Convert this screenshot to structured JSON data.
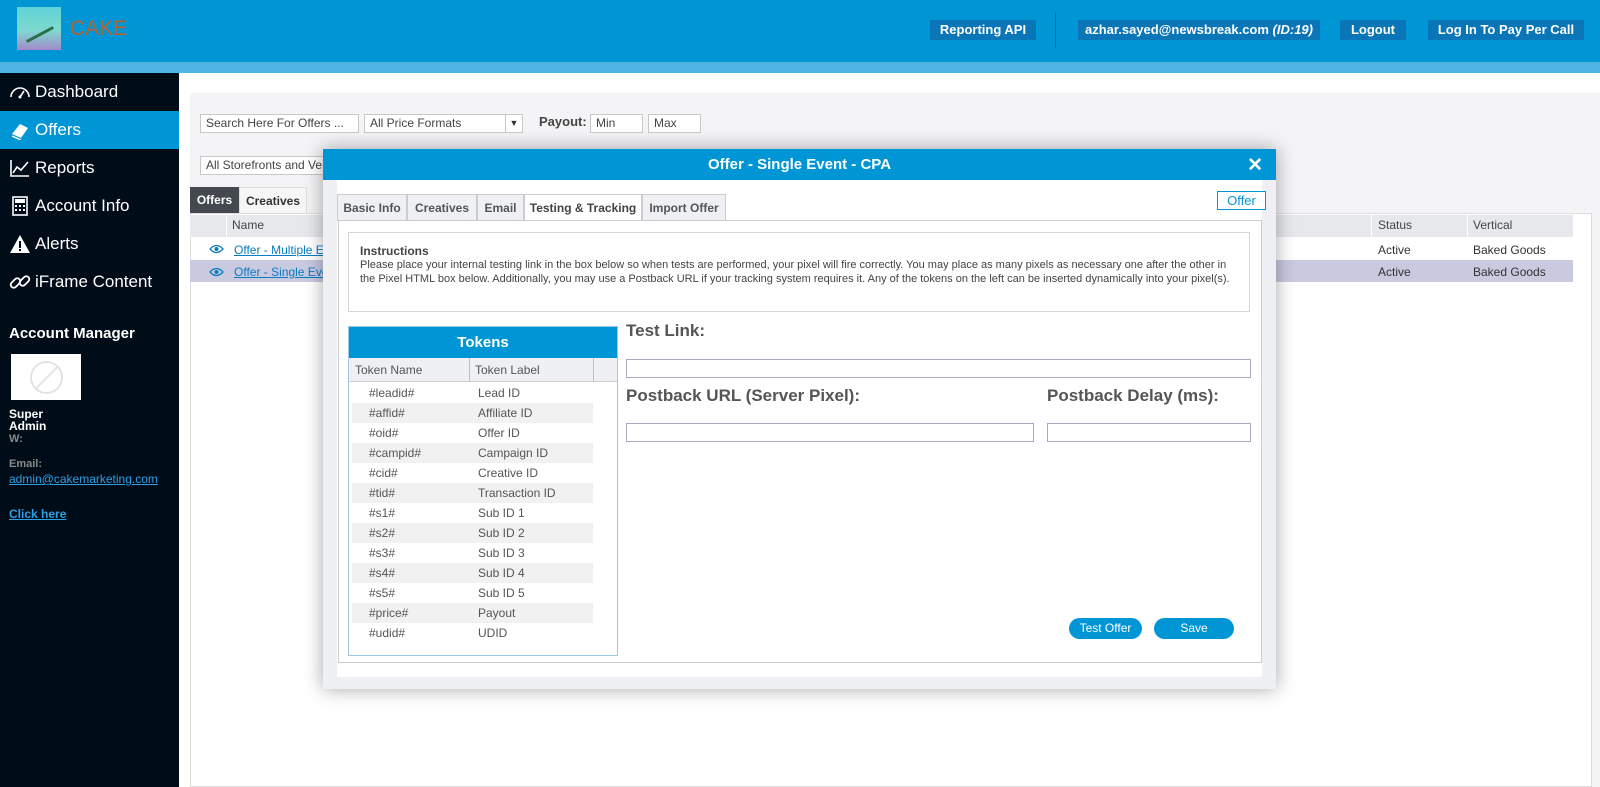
{
  "brand": {
    "name": "CAKE"
  },
  "topbar": {
    "reporting_api": "Reporting API",
    "user_email": "azhar.sayed@newsbreak.com",
    "user_id": "(ID:19)",
    "logout": "Logout",
    "pay_per_call": "Log In To Pay Per Call"
  },
  "sidebar": {
    "items": [
      {
        "label": "Dashboard",
        "icon": "gauge-icon"
      },
      {
        "label": "Offers",
        "icon": "offers-icon"
      },
      {
        "label": "Reports",
        "icon": "chart-icon"
      },
      {
        "label": "Account Info",
        "icon": "calculator-icon"
      },
      {
        "label": "Alerts",
        "icon": "warning-icon"
      },
      {
        "label": "iFrame Content",
        "icon": "link-icon"
      }
    ],
    "account_manager": {
      "title": "Account Manager",
      "name": "Super Admin",
      "w_label": "W:",
      "email_label": "Email:",
      "email": "admin@cakemarketing.com",
      "click_here": "Click here"
    }
  },
  "filters": {
    "search_placeholder": "Search Here For Offers ...",
    "price_format": "All Price Formats",
    "payout_label": "Payout:",
    "payout_min": "Min",
    "payout_max": "Max",
    "storefronts": "All Storefronts and Ver"
  },
  "main_tabs": {
    "offers": "Offers",
    "creatives": "Creatives"
  },
  "grid": {
    "columns": {
      "name": "Name",
      "status": "Status",
      "vertical": "Vertical"
    },
    "rows": [
      {
        "name": "Offer - Multiple Ev",
        "status": "Active",
        "vertical": "Baked Goods"
      },
      {
        "name": "Offer - Single Eve",
        "status": "Active",
        "vertical": "Baked Goods"
      }
    ]
  },
  "modal": {
    "title": "Offer - Single Event - CPA",
    "close": "✕",
    "badge": "Offer",
    "tabs": [
      "Basic Info",
      "Creatives",
      "Email",
      "Testing & Tracking",
      "Import Offer"
    ],
    "active_tab": "Testing & Tracking",
    "instructions_title": "Instructions",
    "instructions_text": "Please place your internal testing link in the box below so when tests are performed, your pixel will fire correctly. You may place as many pixels as necessary one after the other in the Pixel HTML box below. Additionally, you may use a Postback URL if your tracking system requires it. Any of the tokens on the left can be inserted dynamically into your pixel(s).",
    "tokens": {
      "title": "Tokens",
      "col_name": "Token Name",
      "col_label": "Token Label",
      "rows": [
        {
          "name": "#leadid#",
          "label": "Lead ID"
        },
        {
          "name": "#affid#",
          "label": "Affiliate ID"
        },
        {
          "name": "#oid#",
          "label": "Offer ID"
        },
        {
          "name": "#campid#",
          "label": "Campaign ID"
        },
        {
          "name": "#cid#",
          "label": "Creative ID"
        },
        {
          "name": "#tid#",
          "label": "Transaction ID"
        },
        {
          "name": "#s1#",
          "label": "Sub ID 1"
        },
        {
          "name": "#s2#",
          "label": "Sub ID 2"
        },
        {
          "name": "#s3#",
          "label": "Sub ID 3"
        },
        {
          "name": "#s4#",
          "label": "Sub ID 4"
        },
        {
          "name": "#s5#",
          "label": "Sub ID 5"
        },
        {
          "name": "#price#",
          "label": "Payout"
        },
        {
          "name": "#udid#",
          "label": "UDID"
        }
      ]
    },
    "test_link_label": "Test Link:",
    "test_link_value": "",
    "postback_label": "Postback URL (Server Pixel):",
    "postback_value": "",
    "delay_label": "Postback Delay (ms):",
    "delay_value": "",
    "test_offer_button": "Test Offer",
    "save_button": "Save"
  },
  "colors": {
    "brand_blue": "#0096d6",
    "sidebar_bg": "#000c17",
    "link_blue": "#0a7cc2"
  }
}
